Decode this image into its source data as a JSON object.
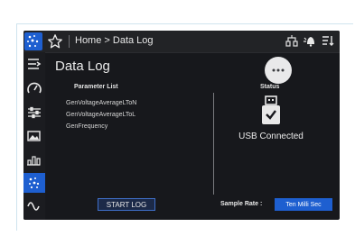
{
  "header": {
    "breadcrumb": "Home > Data Log"
  },
  "icons": {
    "app": "app-network-icon",
    "favorite": "star-icon",
    "top_right": [
      "tree-icon",
      "alarm-bell-icon",
      "sort-list-icon"
    ],
    "sidebar": [
      "menu-expand-icon",
      "gauge-icon",
      "sliders-icon",
      "photo-icon",
      "bar-chart-icon",
      "data-log-icon",
      "waveform-icon"
    ]
  },
  "page": {
    "title": "Data Log"
  },
  "parameters": {
    "header": "Parameter List",
    "items": [
      "GenVoltageAverageLToN",
      "GenVoltageAverageLToL",
      "GenFrequency"
    ]
  },
  "status": {
    "header": "Status",
    "value": "USB Connected"
  },
  "actions": {
    "start_log": "START LOG"
  },
  "sample_rate": {
    "label": "Sample Rate :",
    "value": "Ten Milli Sec"
  },
  "colors": {
    "accent": "#1e5fd0",
    "background": "#17181c",
    "text": "#eaeaea"
  }
}
